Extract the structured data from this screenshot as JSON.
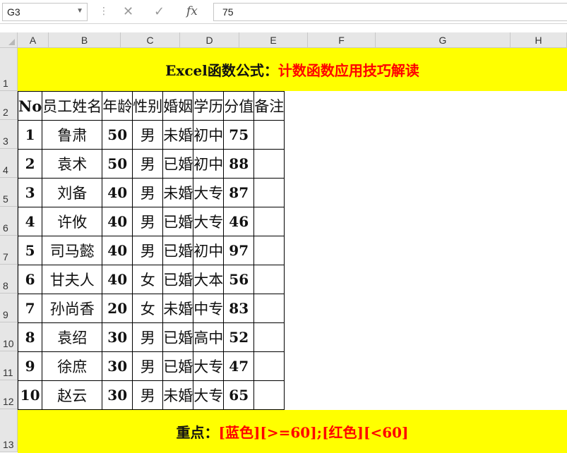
{
  "formula_bar": {
    "cell_ref": "G3",
    "value": "75",
    "cancel_icon": "cancel-icon",
    "confirm_icon": "confirm-icon",
    "fx_label": "fx"
  },
  "columns": [
    "A",
    "B",
    "C",
    "D",
    "E",
    "F",
    "G",
    "H"
  ],
  "rows": [
    "1",
    "2",
    "3",
    "4",
    "5",
    "6",
    "7",
    "8",
    "9",
    "10",
    "11",
    "12",
    "13"
  ],
  "title": {
    "part1": "Excel函数公式：",
    "part2": "计数函数应用技巧解读"
  },
  "table": {
    "headers": [
      "No",
      "员工姓名",
      "年龄",
      "性别",
      "婚姻",
      "学历",
      "分值",
      "备注"
    ],
    "rows": [
      [
        "1",
        "鲁肃",
        "50",
        "男",
        "未婚",
        "初中",
        "75",
        ""
      ],
      [
        "2",
        "袁术",
        "50",
        "男",
        "已婚",
        "初中",
        "88",
        ""
      ],
      [
        "3",
        "刘备",
        "40",
        "男",
        "未婚",
        "大专",
        "87",
        ""
      ],
      [
        "4",
        "许攸",
        "40",
        "男",
        "已婚",
        "大专",
        "46",
        ""
      ],
      [
        "5",
        "司马懿",
        "40",
        "男",
        "已婚",
        "初中",
        "97",
        ""
      ],
      [
        "6",
        "甘夫人",
        "40",
        "女",
        "已婚",
        "大本",
        "56",
        ""
      ],
      [
        "7",
        "孙尚香",
        "20",
        "女",
        "未婚",
        "中专",
        "83",
        ""
      ],
      [
        "8",
        "袁绍",
        "30",
        "男",
        "已婚",
        "高中",
        "52",
        ""
      ],
      [
        "9",
        "徐庶",
        "30",
        "男",
        "已婚",
        "大专",
        "47",
        ""
      ],
      [
        "10",
        "赵云",
        "30",
        "男",
        "未婚",
        "大专",
        "65",
        ""
      ]
    ]
  },
  "footer": {
    "part1": "重点：",
    "part2": "[蓝色][>=60];[红色][<60]"
  },
  "colors": {
    "band_bg": "#ffff00",
    "accent_red": "#ff0000",
    "header_bg": "#e6e6e6"
  }
}
